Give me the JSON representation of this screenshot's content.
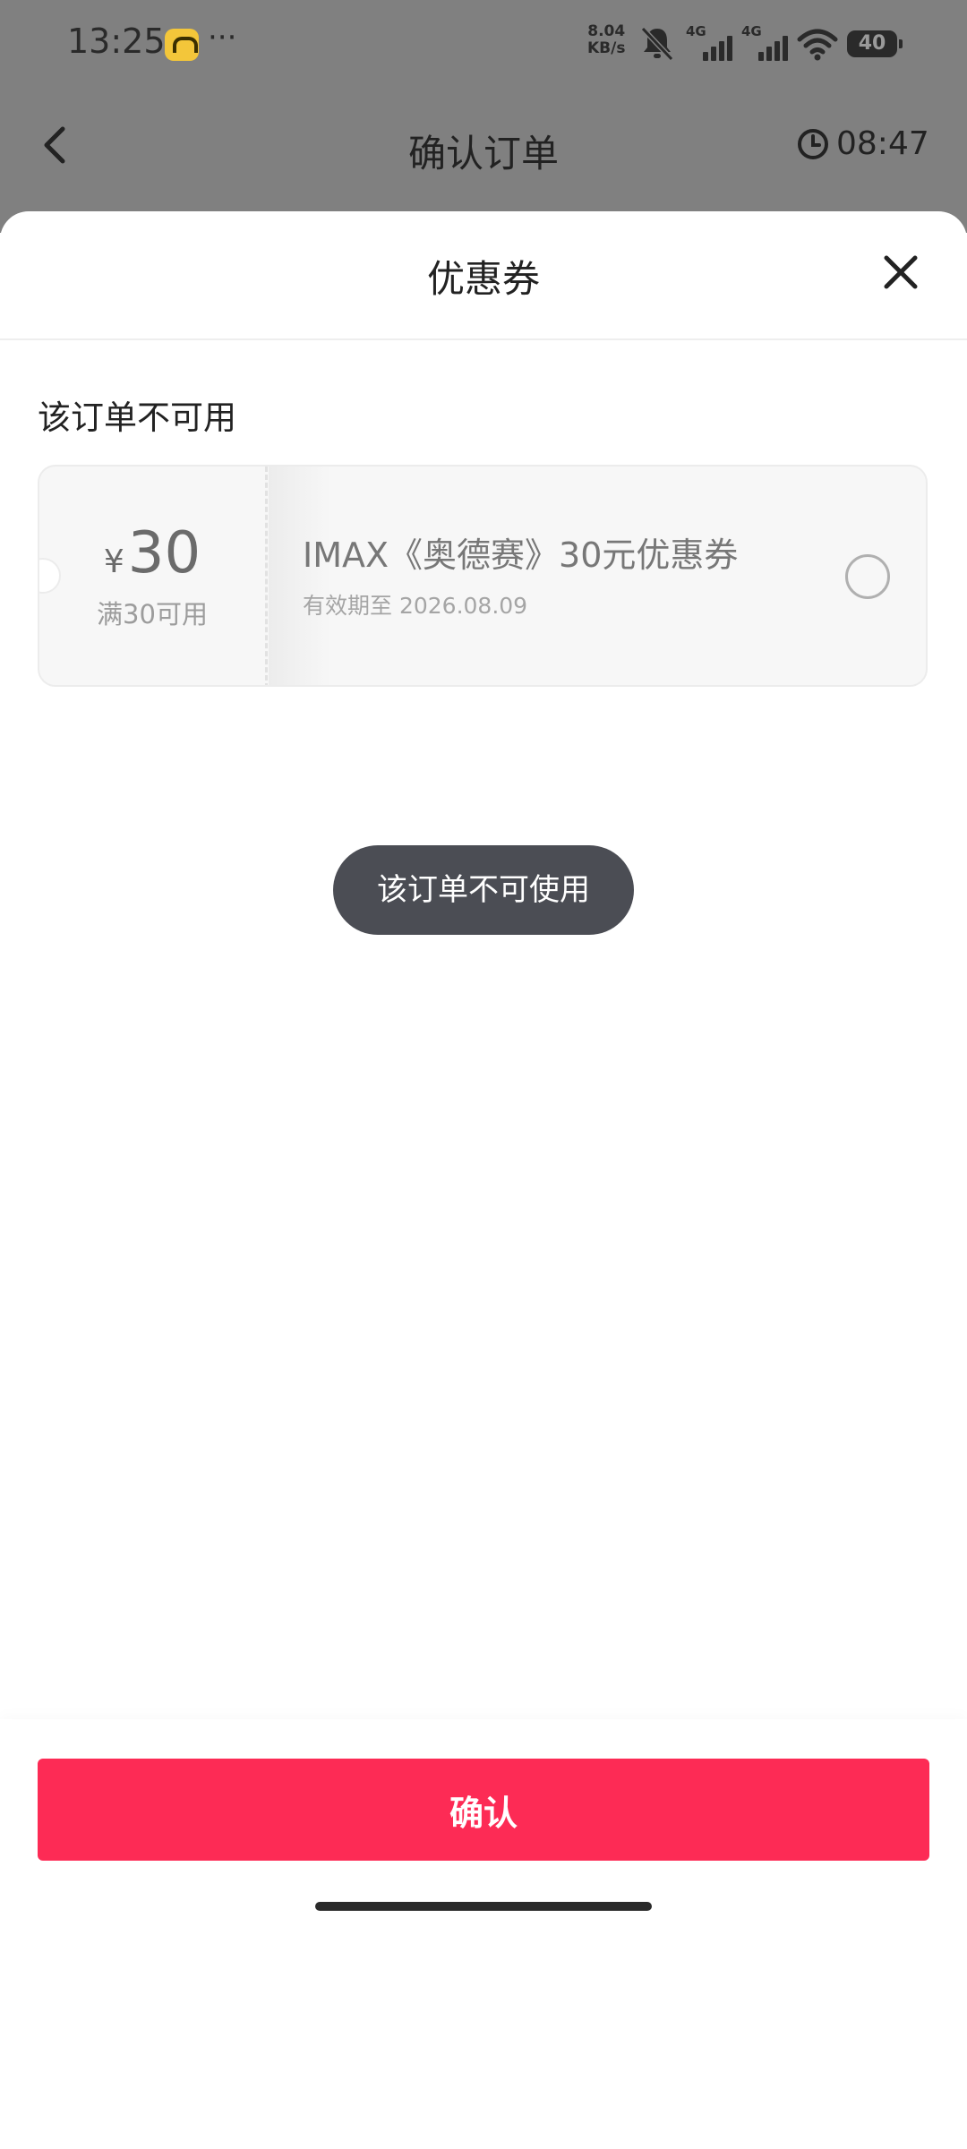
{
  "status_bar": {
    "time": "13:25",
    "dots": "···",
    "net_speed_value": "8.04",
    "net_speed_unit": "KB/s",
    "signal_1_label": "4G",
    "signal_2_label": "4G",
    "battery": "40"
  },
  "background_page": {
    "title": "确认订单",
    "countdown": "08:47"
  },
  "sheet": {
    "title": "优惠券",
    "section_label": "该订单不可用",
    "coupon": {
      "currency": "¥",
      "amount": "30",
      "threshold": "满30可用",
      "name": "IMAX《奥德赛》30元优惠券",
      "expiry": "有效期至 2026.08.09",
      "selected": false
    },
    "toast": "该订单不可使用",
    "confirm_label": "确认"
  },
  "colors": {
    "accent": "#fd2b55",
    "toast_bg": "#4b4d54",
    "overlay": "#808080"
  },
  "icons": [
    "back-arrow-icon",
    "clock-icon",
    "close-icon",
    "wifi-icon",
    "mute-bell-icon",
    "signal-icon",
    "battery-icon"
  ]
}
